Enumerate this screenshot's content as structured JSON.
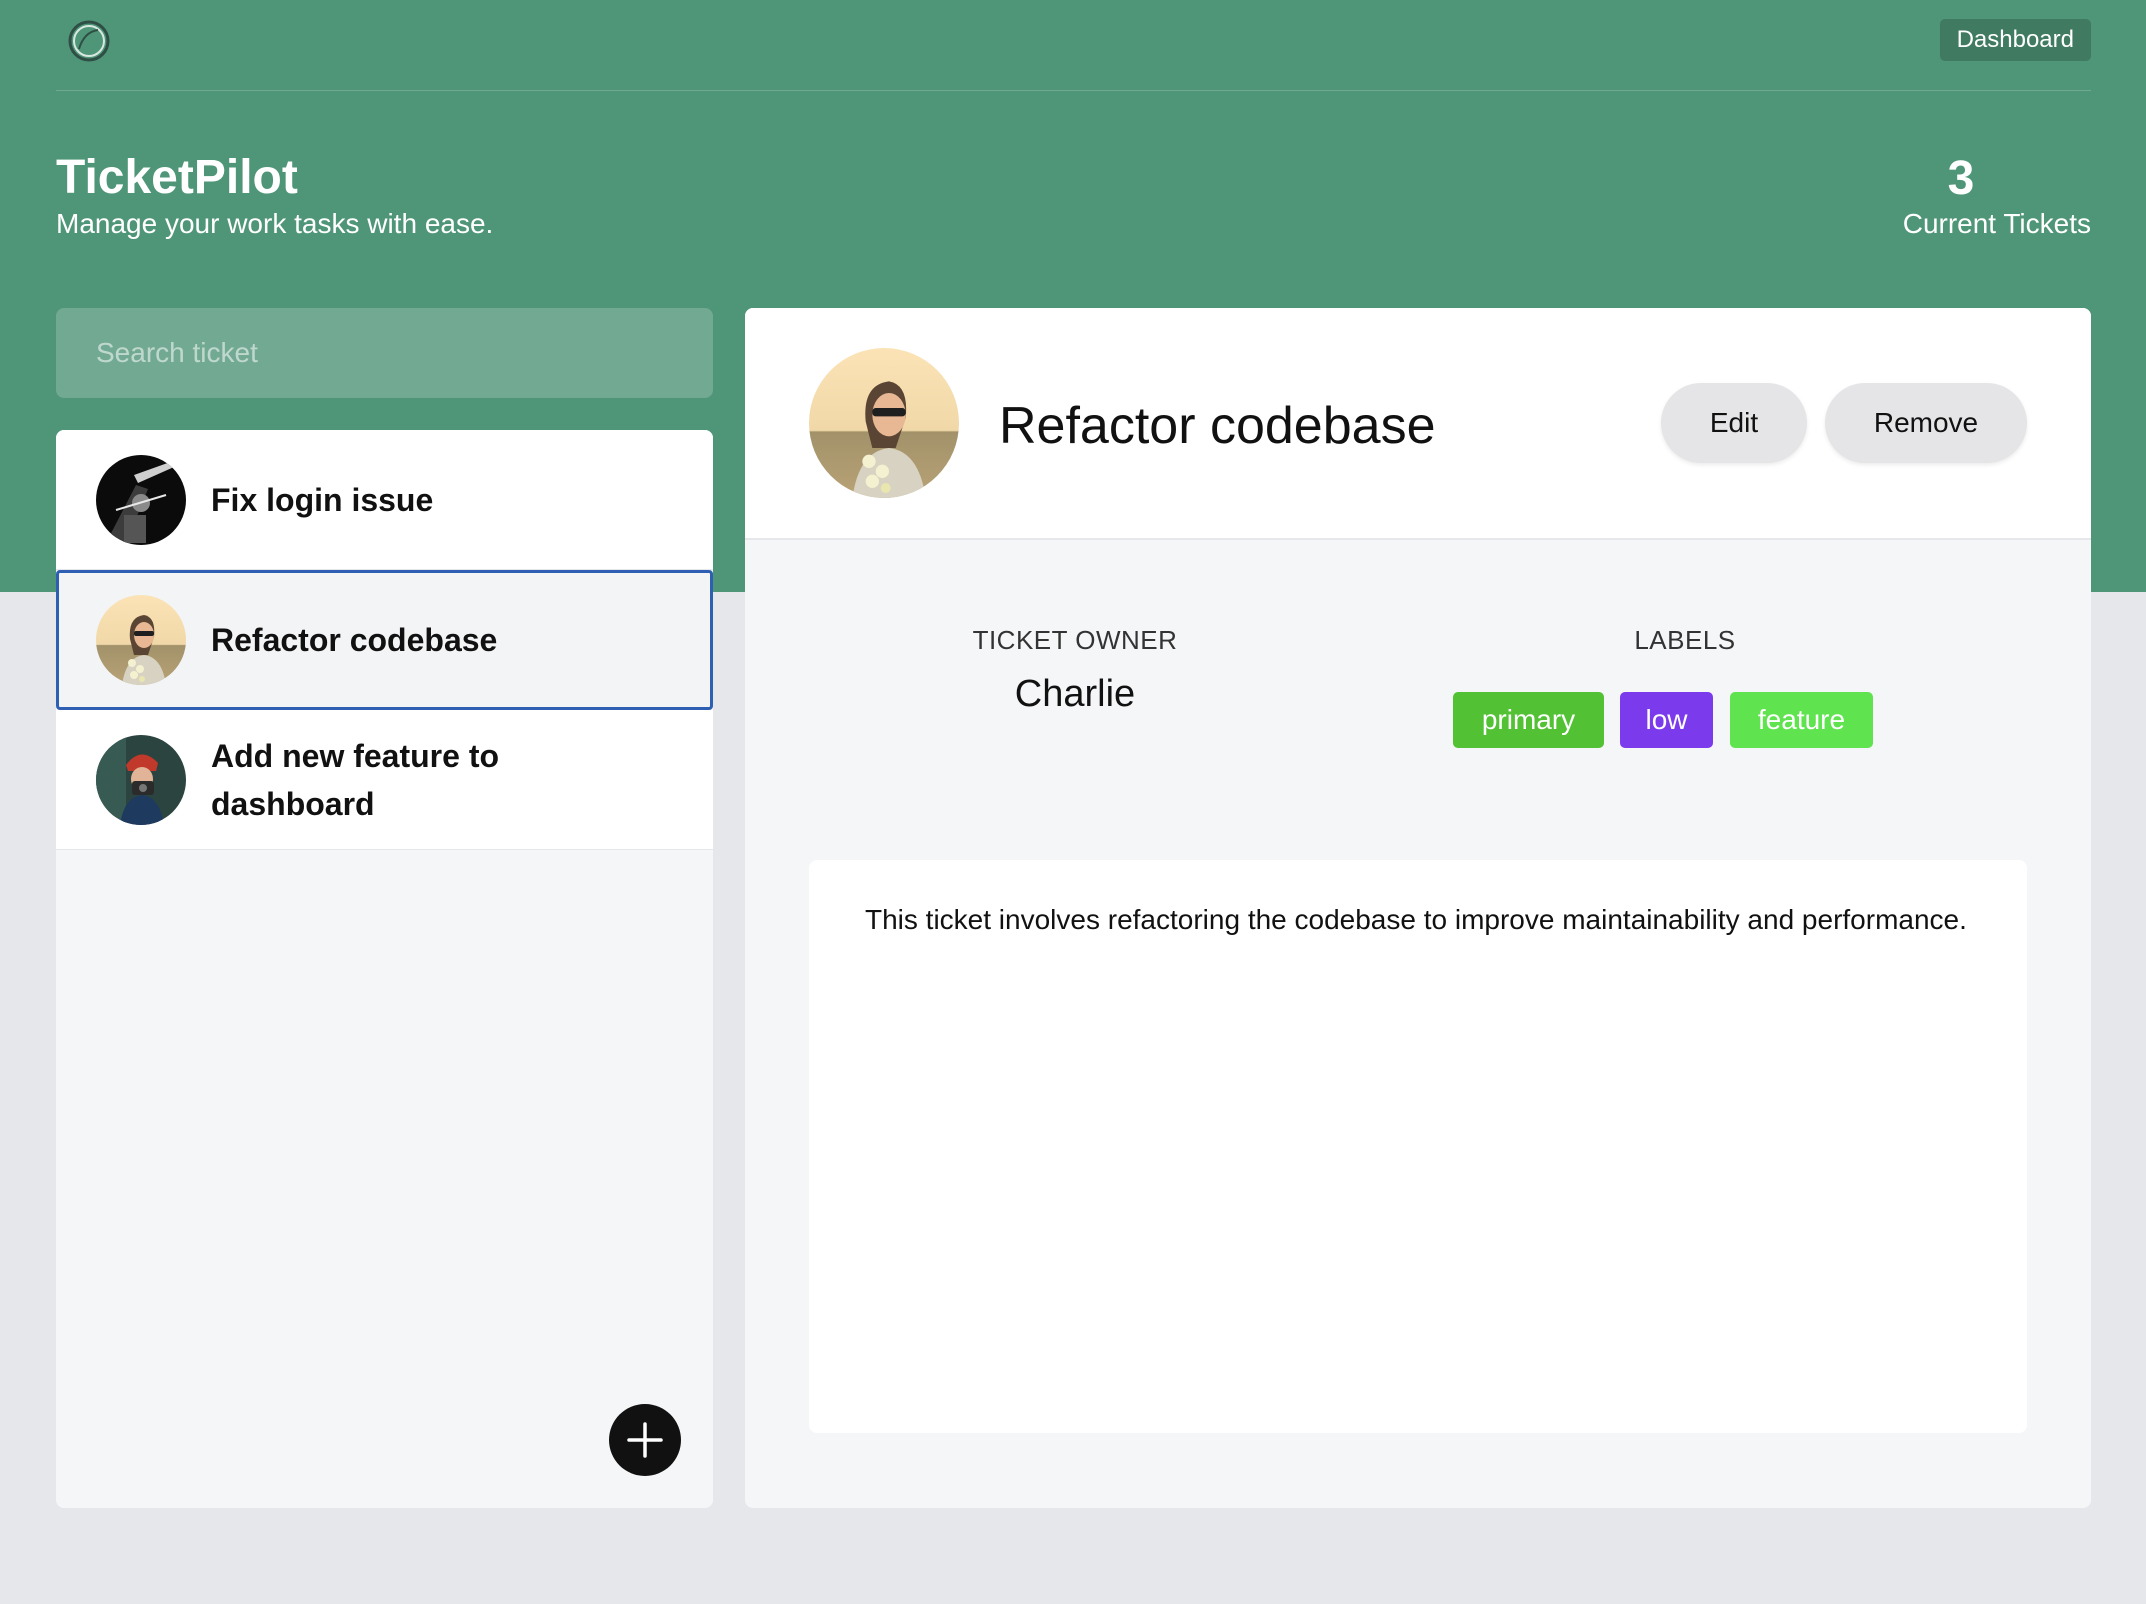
{
  "nav": {
    "logo_icon": "circle-logo-icon",
    "dashboard_label": "Dashboard"
  },
  "header": {
    "title": "TicketPilot",
    "subtitle": "Manage your work tasks with ease.",
    "ticket_count": "3",
    "ticket_count_label": "Current Tickets"
  },
  "search": {
    "placeholder": "Search ticket"
  },
  "tickets": [
    {
      "title": "Fix login issue",
      "avatar": "avatar-image",
      "selected": false
    },
    {
      "title": "Refactor codebase",
      "avatar": "avatar-image",
      "selected": true
    },
    {
      "title": "Add new feature to dashboard",
      "avatar": "avatar-image",
      "selected": false
    }
  ],
  "add_button_icon": "plus-icon",
  "detail": {
    "title": "Refactor codebase",
    "edit_label": "Edit",
    "remove_label": "Remove",
    "owner_heading": "TICKET OWNER",
    "owner_name": "Charlie",
    "labels_heading": "LABELS",
    "labels": [
      {
        "text": "primary",
        "color": "#52c234"
      },
      {
        "text": "low",
        "color": "#7c3aed"
      },
      {
        "text": "feature",
        "color": "#5fe34f"
      }
    ],
    "description": "This ticket involves refactoring the codebase to improve maintainability and performance."
  },
  "colors": {
    "header_green": "#4f9678",
    "page_background": "#e5e7eb",
    "selection_border": "#2e5fb3"
  }
}
